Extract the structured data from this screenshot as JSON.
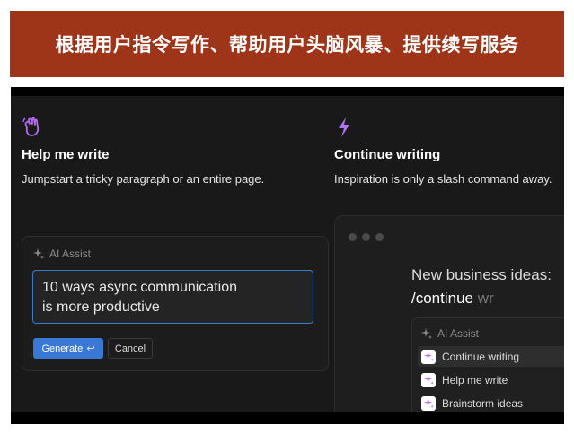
{
  "banner": {
    "title": "根据用户指令写作、帮助用户头脑风暴、提供续写服务"
  },
  "left_feature": {
    "title": "Help me write",
    "description": "Jumpstart a tricky paragraph or an entire page."
  },
  "right_feature": {
    "title": "Continue writing",
    "description": "Inspiration is only a slash command away."
  },
  "assist_panel": {
    "header": "AI Assist",
    "prompt_line1": "10 ways async communication",
    "prompt_line2": "is more productive",
    "generate_label": "Generate",
    "return_glyph": "↩",
    "cancel_label": "Cancel"
  },
  "editor": {
    "line1": "New business ideas:",
    "command_typed": "/continue",
    "command_ghost": " wr"
  },
  "slash_menu": {
    "header": "AI Assist",
    "items": [
      {
        "label": "Continue writing"
      },
      {
        "label": "Help me write"
      },
      {
        "label": "Brainstorm ideas"
      }
    ]
  },
  "colors": {
    "banner": "#9e3418",
    "accent_purple": "#b174ee",
    "wave_orange": "#b46cf0",
    "button_blue": "#3a78d6"
  }
}
